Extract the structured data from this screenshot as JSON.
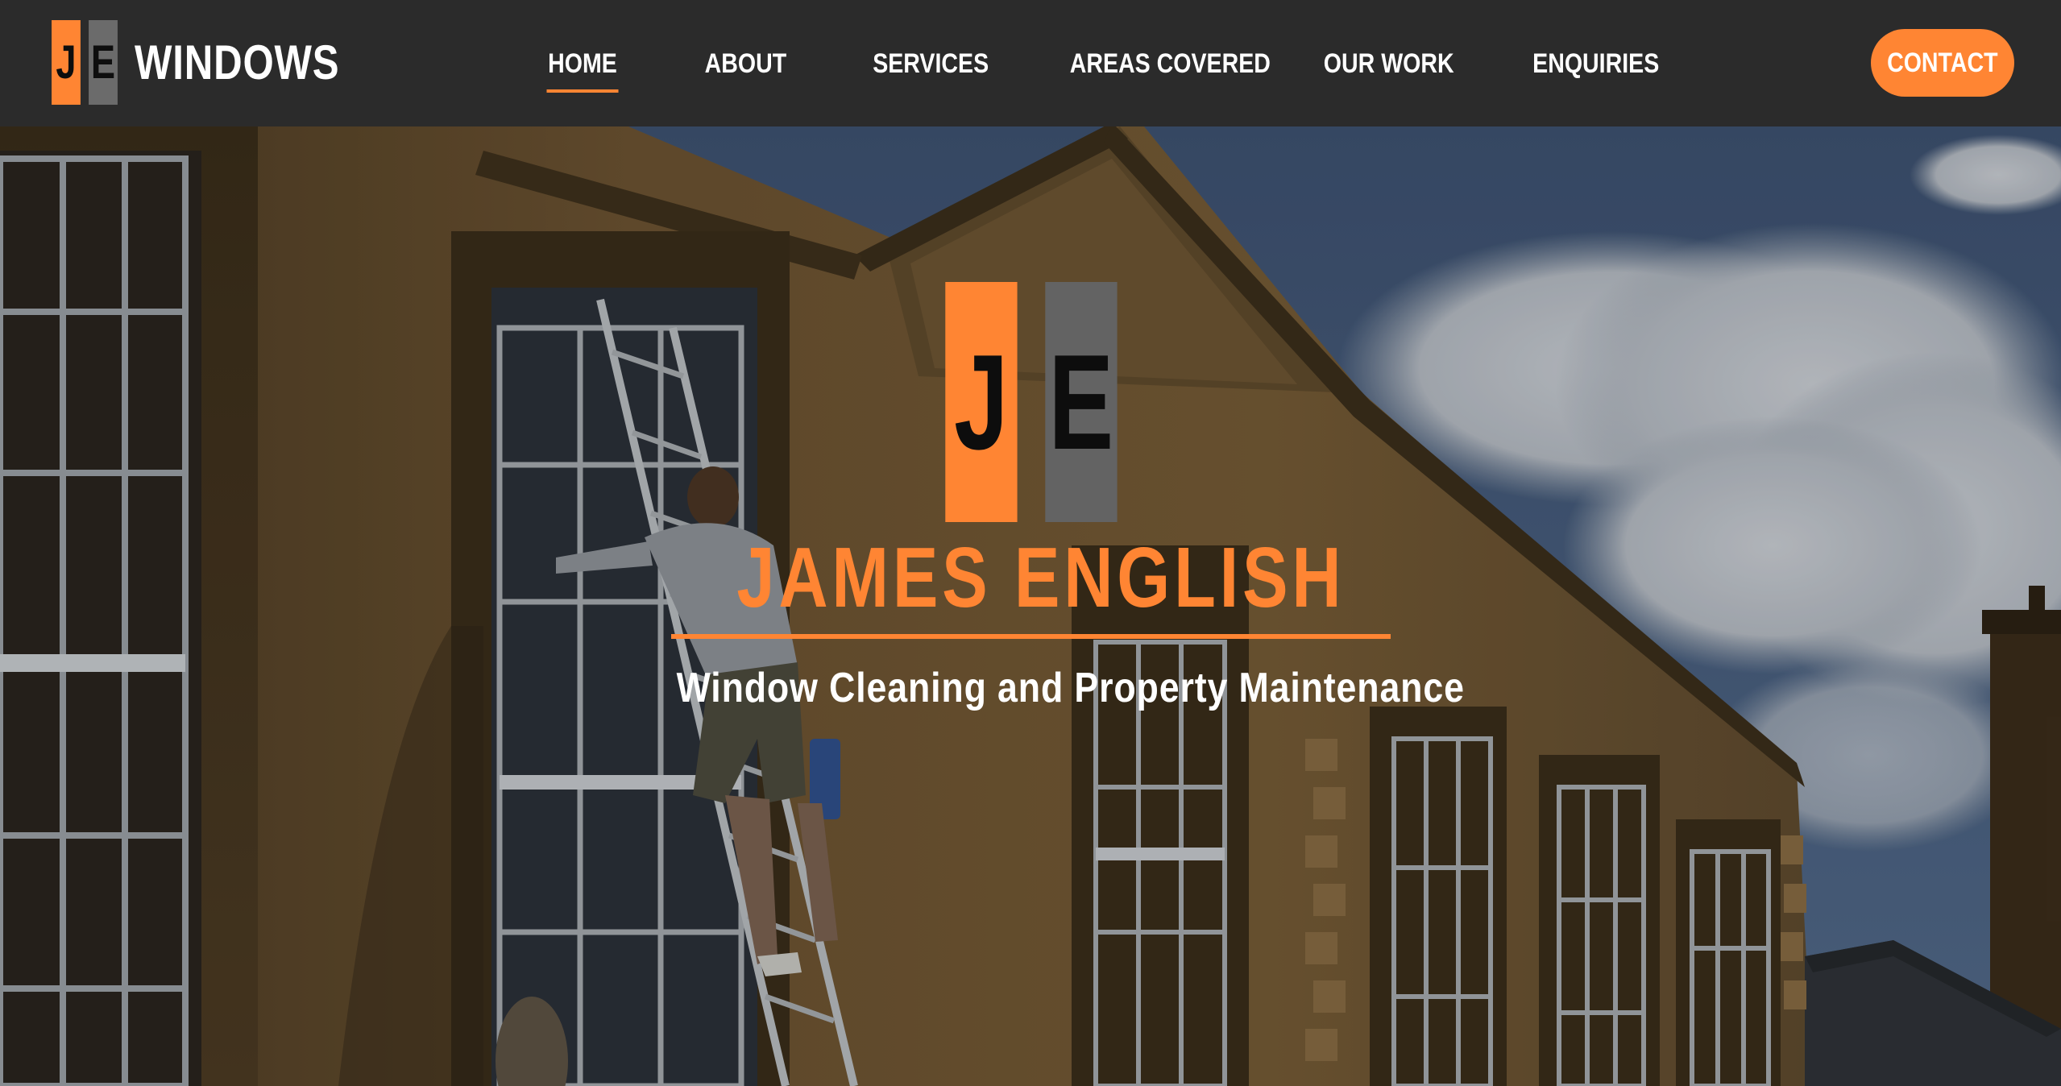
{
  "brand": {
    "logo_letter_left": "J",
    "logo_letter_right": "E",
    "name": "WINDOWS"
  },
  "nav": {
    "items": [
      {
        "label": "HOME",
        "active": true
      },
      {
        "label": "ABOUT",
        "active": false
      },
      {
        "label": "SERVICES",
        "active": false
      },
      {
        "label": "AREAS COVERED",
        "active": false
      },
      {
        "label": "OUR WORK",
        "active": false
      },
      {
        "label": "ENQUIRIES",
        "active": false
      }
    ],
    "contact_label": "CONTACT"
  },
  "hero": {
    "logo_letter_left": "J",
    "logo_letter_right": "E",
    "title": "JAMES ENGLISH",
    "subtitle": "Window Cleaning and Property Maintenance"
  },
  "colors": {
    "accent": "#ff8533",
    "nav_background": "#2b2b2b",
    "logo_grey": "#636363",
    "text_light": "#ffffff"
  }
}
